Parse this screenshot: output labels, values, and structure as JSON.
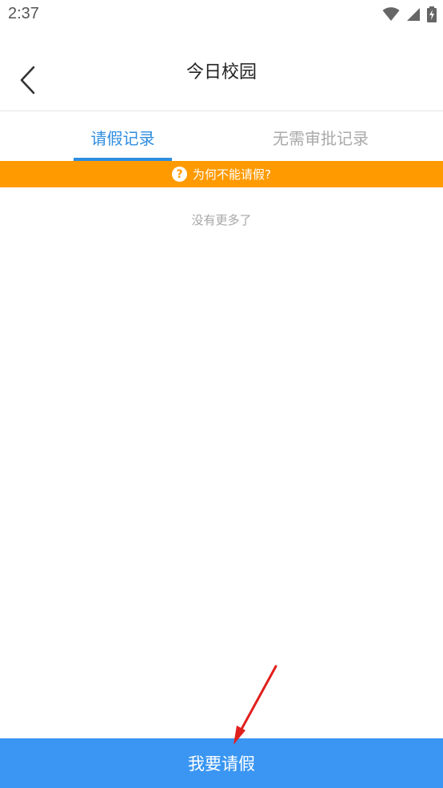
{
  "status_bar": {
    "time": "2:37"
  },
  "header": {
    "title": "今日校园"
  },
  "tabs": [
    {
      "label": "请假记录",
      "active": true
    },
    {
      "label": "无需审批记录",
      "active": false
    }
  ],
  "notice": {
    "text": "为何不能请假?"
  },
  "list": {
    "empty_text": "没有更多了"
  },
  "bottom": {
    "button_label": "我要请假"
  },
  "colors": {
    "accent": "#2e8de0",
    "notice_bg": "#ff9a00",
    "button_bg": "#3a96f2",
    "annotation_arrow": "#e0201e"
  }
}
